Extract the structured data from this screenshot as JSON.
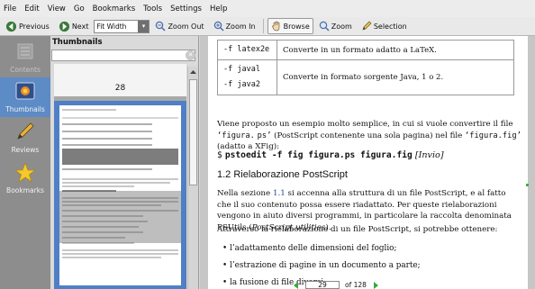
{
  "menu": {
    "items": [
      "File",
      "Edit",
      "View",
      "Go",
      "Bookmarks",
      "Tools",
      "Settings",
      "Help"
    ]
  },
  "toolbar": {
    "previous": "Previous",
    "next": "Next",
    "zoom_mode": "Fit Width",
    "zoom_out": "Zoom Out",
    "zoom_in": "Zoom In",
    "browse": "Browse",
    "zoom": "Zoom",
    "selection": "Selection"
  },
  "sidebar": {
    "contents": "Contents",
    "thumbnails": "Thumbnails",
    "reviews": "Reviews",
    "bookmarks": "Bookmarks"
  },
  "thumbnails": {
    "title": "Thumbnails",
    "search_value": "",
    "page_label": "28"
  },
  "document": {
    "table": [
      {
        "option": "-f latex2e",
        "desc": "Converte in un formato adatto a LaTeX."
      },
      {
        "option": "-f javal",
        "option2": "-f java2",
        "desc": "Converte in formato sorgente Java, 1 o 2."
      }
    ],
    "para1_a": "Viene proposto un esempio molto semplice, in cui si vuole convertire il file ",
    "para1_code1": "‘figura.",
    "para1_code2": "ps’",
    "para1_b": " (PostScript contenente una sola pagina) nel file ",
    "para1_code3": "‘figura.fig’",
    "para1_c": " (adatto a XFig):",
    "cmd_prompt": "$",
    "cmd": "pstoedit -f fig figura.ps figura.fig",
    "cmd_invio": "[Invio]",
    "heading": "1.2 Rielaborazione PostScript",
    "para2_a": "Nella sezione ",
    "para2_ref": "1.1",
    "para2_b": " si accenna alla struttura di un file PostScript, e al fatto che il suo contenuto possa essere riadattato. Per queste rielaborazioni vengono in aiuto diversi programmi, in particolare la raccolta denominata PSUtils (",
    "para2_em": "PostScript utilities",
    "para2_c": ").",
    "para3": "Attraverso la rielaborazione di un file PostScript, si potrebbe ottenere:",
    "bullets": [
      "l’adattamento delle dimensioni del foglio;",
      "l’estrazione di pagine in un documento a parte;",
      "la fusione di file diversi;"
    ]
  },
  "status": {
    "page_current": "29",
    "page_of": "of",
    "page_total": "128"
  },
  "colors": {
    "selection_blue": "#4f7fc5",
    "sidebar_grey": "#8d8d8d",
    "ref_blue": "#2244aa",
    "nav_green": "#3aa83a"
  }
}
